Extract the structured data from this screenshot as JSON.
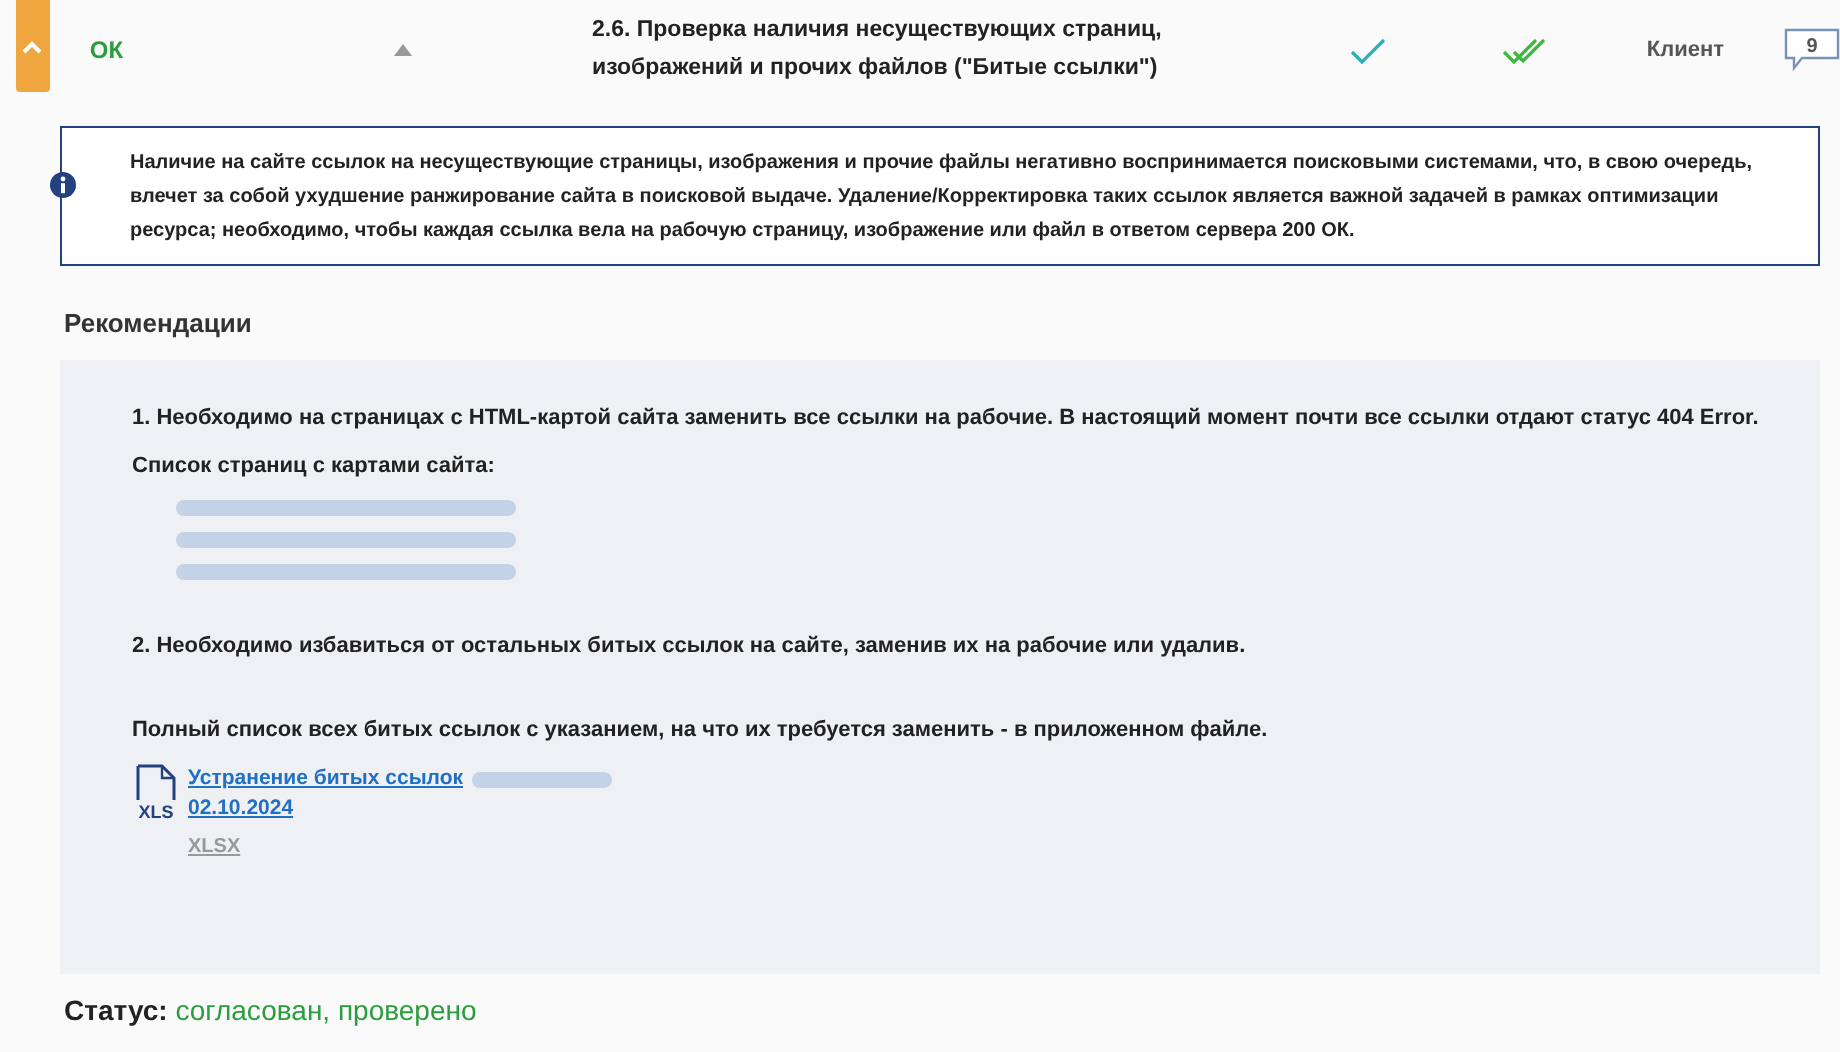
{
  "row": {
    "expanded": true,
    "status": "ОК",
    "title": "2.6. Проверка наличия несуществующих страниц, изображений и прочих файлов (\"Битые ссылки\")",
    "checked": true,
    "verified": true,
    "responsible": "Клиент",
    "comments": "9"
  },
  "info": {
    "text": "Наличие на сайте ссылок на несуществующие страницы, изображения и прочие файлы негативно воспринимается поисковыми системами, что, в свою очередь, влечет за собой ухудшение ранжирование сайта в поисковой выдаче. Удаление/Корректировка таких ссылок является важной задачей в рамках оптимизации ресурса; необходимо, чтобы каждая ссылка вела на рабочую страницу, изображение или файл в ответом сервера 200 ОК."
  },
  "recommendations": {
    "heading": "Рекомендации",
    "items": [
      {
        "kind": "paragraph",
        "text": "1. Необходимо на страницах с HTML-картой сайта заменить все ссылки на рабочие. В настоящий момент почти все ссылки отдают статус 404 Error."
      },
      {
        "kind": "paragraph",
        "text": "Список страниц с картами сайта:"
      },
      {
        "kind": "redacted"
      },
      {
        "kind": "redacted"
      },
      {
        "kind": "redacted"
      },
      {
        "kind": "spacer"
      },
      {
        "kind": "paragraph",
        "text": "2. Необходимо избавиться от остальных битых ссылок на сайте, заменив их на рабочие или удалив."
      },
      {
        "kind": "spacer"
      },
      {
        "kind": "paragraph",
        "text": "Полный список всех битых ссылок с указанием, на что их требуется заменить - в приложенном файле."
      },
      {
        "kind": "file",
        "icon_label": "XLS",
        "name": "Устранение битых ссылок",
        "date": "02.10.2024",
        "type": "XLSX"
      }
    ]
  },
  "status": {
    "label": "Статус:",
    "value": "согласован, проверено"
  }
}
